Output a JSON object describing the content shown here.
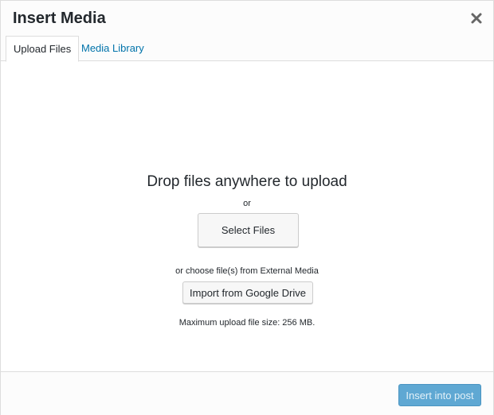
{
  "header": {
    "title": "Insert Media",
    "close_icon": "close-icon"
  },
  "tabs": [
    {
      "label": "Upload Files",
      "active": true
    },
    {
      "label": "Media Library",
      "active": false
    }
  ],
  "upload": {
    "drop_title": "Drop files anywhere to upload",
    "or_text": "or",
    "select_button": "Select Files",
    "external_text": "or choose file(s) from External Media",
    "drive_button": "Import from Google Drive",
    "max_size_text": "Maximum upload file size: 256 MB."
  },
  "footer": {
    "insert_button": "Insert into post",
    "insert_disabled": true
  },
  "colors": {
    "link": "#0073aa",
    "primary_disabled": "#5fa8d3",
    "border": "#dddddd"
  }
}
